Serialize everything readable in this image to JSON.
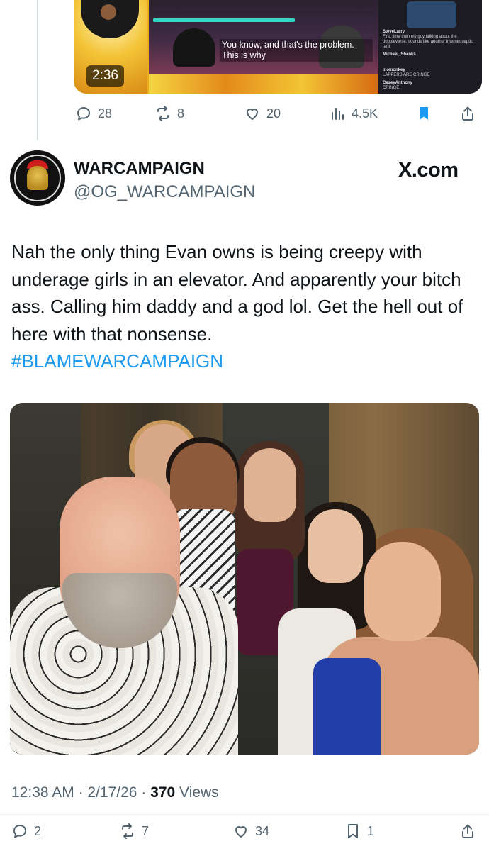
{
  "quoted_video": {
    "duration": "2:36",
    "caption": "You know, and that's the problem. This is why",
    "chat": [
      {
        "name": "SteveLarry",
        "text": "First time then my guy talking about the dobbleverse, sounds like another internet septic tank"
      },
      {
        "name": "Michael_Shanks",
        "text": ""
      },
      {
        "name": "momonkey",
        "text": "LAPPERS ARE CRINGE"
      },
      {
        "name": "CaseyAnthony",
        "text": "CRINGE!"
      }
    ]
  },
  "previous_actions": {
    "replies": "28",
    "reposts": "8",
    "likes": "20",
    "views": "4.5K"
  },
  "author": {
    "display_name": "WARCAMPAIGN",
    "handle": "@OG_WARCAMPAIGN",
    "avatar_icon": "spartan-helmet-logo"
  },
  "watermark": "X.com",
  "post": {
    "text": "Nah the only thing Evan owns is being creepy with underage girls in an elevator.  And apparently your bitch ass.  Calling him daddy and a god lol.  Get the hell out of here with that nonsense.",
    "hashtag": "#BLAMEWARCAMPAIGN"
  },
  "meta": {
    "time": "12:38 AM",
    "sep1": " · ",
    "date": "2/17/26",
    "sep2": " · ",
    "views_count": "370",
    "views_label": " Views"
  },
  "actions": {
    "replies": "2",
    "reposts": "7",
    "likes": "34",
    "bookmarks": "1"
  },
  "colors": {
    "text": "#0f1419",
    "secondary": "#536471",
    "link": "#1d9bf0",
    "bookmark_active": "#1d9bf0"
  }
}
